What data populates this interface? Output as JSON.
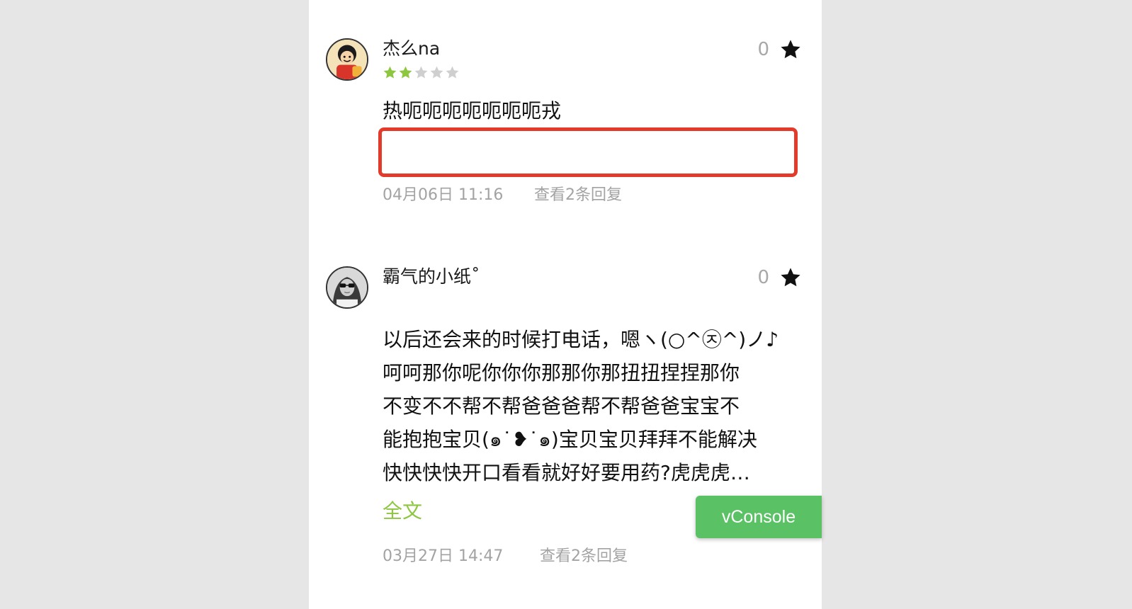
{
  "colors": {
    "accent_green": "#8dc63f",
    "star_empty": "#cfcfcf",
    "highlight_red": "#e23b2b",
    "vconsole_green": "#5ac164"
  },
  "comments": [
    {
      "username": "杰么na",
      "avatar_icon": "cartoon-avatar-icon",
      "rating": 2,
      "rating_max": 5,
      "like_count": "0",
      "content_lines": [
        "热呃呃呃呃呃呃呃戎"
      ],
      "reply_box_value": "",
      "time": "04月06日 11:16",
      "reply_link": "查看2条回复"
    },
    {
      "username": "霸气的小纸˚",
      "avatar_icon": "photo-avatar-icon",
      "like_count": "0",
      "content_lines": [
        "以后还会来的时候打电话，嗯ヽ(○^㉨^)ノ♪",
        "呵呵那你呢你你你那那你那扭扭捏捏那你",
        "不变不不帮不帮爸爸爸帮不帮爸爸宝宝不",
        "能抱抱宝贝(๑˙❥˙๑)宝贝宝贝拜拜不能解决",
        "快快快快开口看看就好好要用药?虎虎虎…"
      ],
      "full_text_link": "全文",
      "time": "03月27日 14:47",
      "reply_link": "查看2条回复"
    }
  ],
  "vconsole": {
    "label": "vConsole"
  }
}
